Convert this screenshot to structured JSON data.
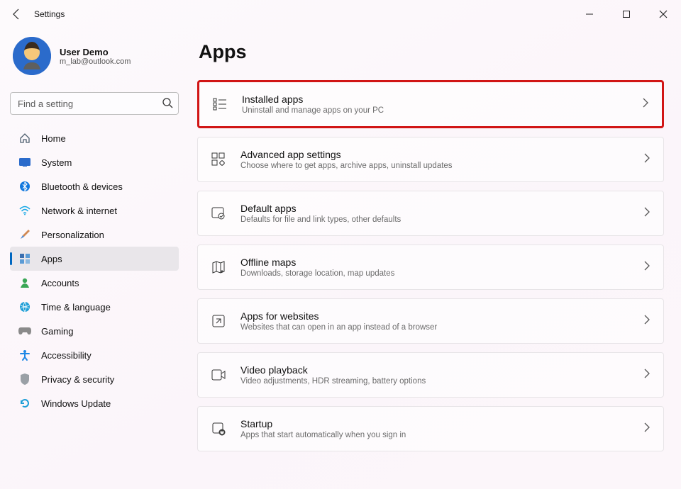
{
  "window": {
    "title": "Settings"
  },
  "user": {
    "name": "User Demo",
    "email": "m_lab@outlook.com"
  },
  "search": {
    "placeholder": "Find a setting"
  },
  "nav": {
    "items": [
      {
        "id": "home",
        "label": "Home"
      },
      {
        "id": "system",
        "label": "System"
      },
      {
        "id": "bluetooth",
        "label": "Bluetooth & devices"
      },
      {
        "id": "network",
        "label": "Network & internet"
      },
      {
        "id": "personalization",
        "label": "Personalization"
      },
      {
        "id": "apps",
        "label": "Apps"
      },
      {
        "id": "accounts",
        "label": "Accounts"
      },
      {
        "id": "time",
        "label": "Time & language"
      },
      {
        "id": "gaming",
        "label": "Gaming"
      },
      {
        "id": "accessibility",
        "label": "Accessibility"
      },
      {
        "id": "privacy",
        "label": "Privacy & security"
      },
      {
        "id": "update",
        "label": "Windows Update"
      }
    ],
    "active": "apps"
  },
  "page": {
    "title": "Apps"
  },
  "cards": [
    {
      "id": "installed",
      "title": "Installed apps",
      "subtitle": "Uninstall and manage apps on your PC",
      "highlight": true
    },
    {
      "id": "advanced",
      "title": "Advanced app settings",
      "subtitle": "Choose where to get apps, archive apps, uninstall updates"
    },
    {
      "id": "default",
      "title": "Default apps",
      "subtitle": "Defaults for file and link types, other defaults"
    },
    {
      "id": "offline",
      "title": "Offline maps",
      "subtitle": "Downloads, storage location, map updates"
    },
    {
      "id": "websites",
      "title": "Apps for websites",
      "subtitle": "Websites that can open in an app instead of a browser"
    },
    {
      "id": "video",
      "title": "Video playback",
      "subtitle": "Video adjustments, HDR streaming, battery options"
    },
    {
      "id": "startup",
      "title": "Startup",
      "subtitle": "Apps that start automatically when you sign in"
    }
  ]
}
